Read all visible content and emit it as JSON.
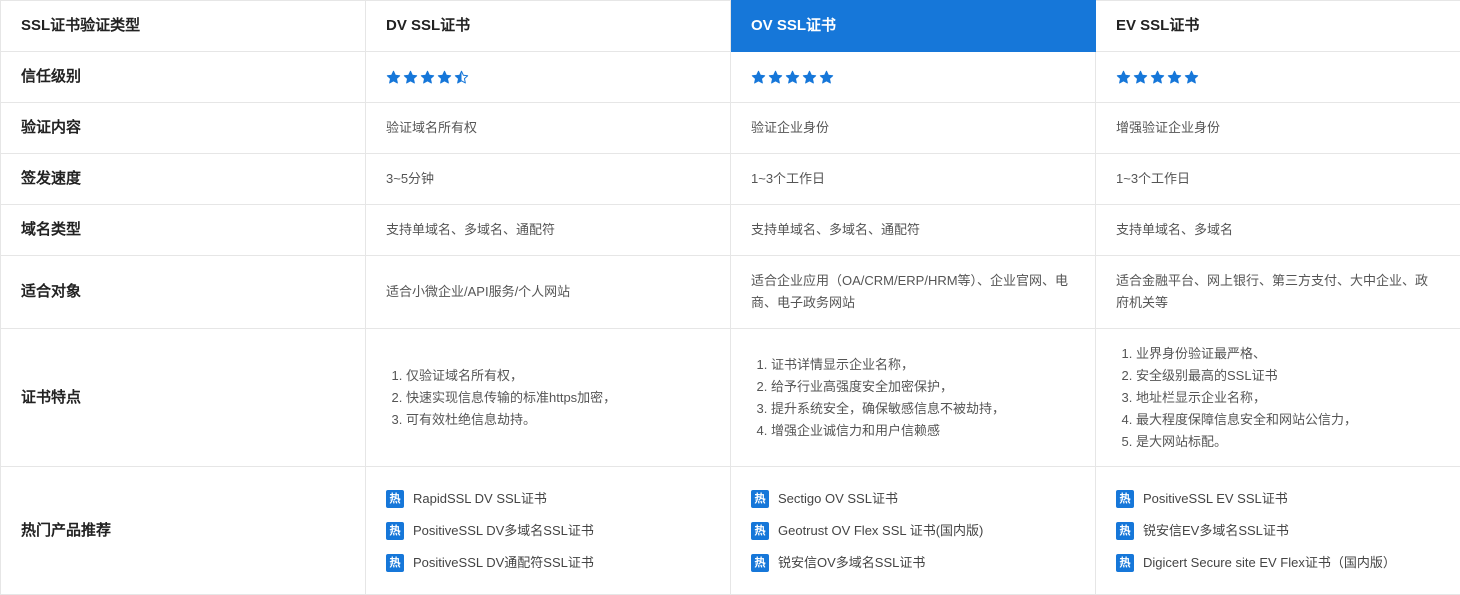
{
  "header": {
    "col0": "SSL证书验证类型",
    "col1": "DV SSL证书",
    "col2": "OV SSL证书",
    "col3": "EV SSL证书",
    "highlight_color": "#1677d9"
  },
  "rows": {
    "trust": {
      "label": "信任级别",
      "dv_stars": 4.5,
      "ov_stars": 5,
      "ev_stars": 5,
      "star_color": "#1677d9",
      "star_icon": "star-icon"
    },
    "verify": {
      "label": "验证内容",
      "dv": "验证域名所有权",
      "ov": "验证企业身份",
      "ev": "增强验证企业身份"
    },
    "speed": {
      "label": "签发速度",
      "dv": "3~5分钟",
      "ov": "1~3个工作日",
      "ev": "1~3个工作日"
    },
    "domain": {
      "label": "域名类型",
      "dv": "支持单域名、多域名、通配符",
      "ov": "支持单域名、多域名、通配符",
      "ev": "支持单域名、多域名"
    },
    "target": {
      "label": "适合对象",
      "dv": "适合小微企业/API服务/个人网站",
      "ov": "适合企业应用（OA/CRM/ERP/HRM等）、企业官网、电商、电子政务网站",
      "ev": "适合金融平台、网上银行、第三方支付、大中企业、政府机关等"
    },
    "features": {
      "label": "证书特点",
      "dv": [
        "仅验证域名所有权，",
        "快速实现信息传输的标准https加密，",
        "可有效杜绝信息劫持。"
      ],
      "ov": [
        "证书详情显示企业名称，",
        "给予行业高强度安全加密保护，",
        "提升系统安全，确保敏感信息不被劫持，",
        "增强企业诚信力和用户信赖感"
      ],
      "ev": [
        "业界身份验证最严格、",
        "安全级别最高的SSL证书",
        "地址栏显示企业名称，",
        "最大程度保障信息安全和网站公信力，",
        "是大网站标配。"
      ]
    },
    "products": {
      "label": "热门产品推荐",
      "hot_badge": "热",
      "dv": [
        "RapidSSL DV SSL证书",
        "PositiveSSL DV多域名SSL证书",
        "PositiveSSL DV通配符SSL证书"
      ],
      "ov": [
        "Sectigo OV SSL证书",
        "Geotrust OV Flex SSL 证书(国内版)",
        "锐安信OV多域名SSL证书"
      ],
      "ev": [
        "PositiveSSL EV SSL证书",
        "锐安信EV多域名SSL证书",
        "Digicert Secure site EV Flex证书（国内版）"
      ]
    }
  }
}
